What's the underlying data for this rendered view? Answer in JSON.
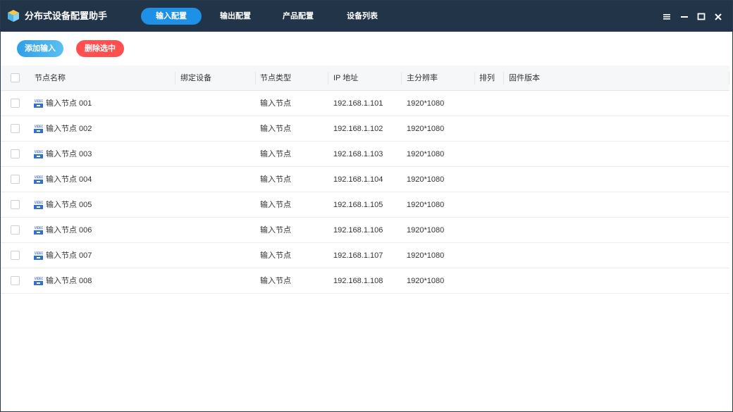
{
  "app": {
    "title": "分布式设备配置助手"
  },
  "tabs": [
    {
      "label": "输入配置",
      "active": true
    },
    {
      "label": "输出配置",
      "active": false
    },
    {
      "label": "产品配置",
      "active": false
    },
    {
      "label": "设备列表",
      "active": false
    }
  ],
  "window_controls": [
    "menu-icon",
    "minimize-icon",
    "maximize-icon",
    "close-icon"
  ],
  "toolbar": {
    "add_label": "添加输入",
    "delete_label": "删除选中"
  },
  "colors": {
    "titlebar": "#223447",
    "accent": "#1e90e6",
    "danger": "#ff4f4f"
  },
  "table": {
    "headers": {
      "name": "节点名称",
      "bind": "绑定设备",
      "type": "节点类型",
      "ip": "IP 地址",
      "resolution": "主分辨率",
      "order": "排列",
      "firmware": "固件版本"
    },
    "rows": [
      {
        "name": "输入节点 001",
        "bind": "",
        "type": "输入节点",
        "ip": "192.168.1.101",
        "resolution": "1920*1080",
        "order": "",
        "firmware": ""
      },
      {
        "name": "输入节点 002",
        "bind": "",
        "type": "输入节点",
        "ip": "192.168.1.102",
        "resolution": "1920*1080",
        "order": "",
        "firmware": ""
      },
      {
        "name": "输入节点 003",
        "bind": "",
        "type": "输入节点",
        "ip": "192.168.1.103",
        "resolution": "1920*1080",
        "order": "",
        "firmware": ""
      },
      {
        "name": "输入节点 004",
        "bind": "",
        "type": "输入节点",
        "ip": "192.168.1.104",
        "resolution": "1920*1080",
        "order": "",
        "firmware": ""
      },
      {
        "name": "输入节点 005",
        "bind": "",
        "type": "输入节点",
        "ip": "192.168.1.105",
        "resolution": "1920*1080",
        "order": "",
        "firmware": ""
      },
      {
        "name": "输入节点 006",
        "bind": "",
        "type": "输入节点",
        "ip": "192.168.1.106",
        "resolution": "1920*1080",
        "order": "",
        "firmware": ""
      },
      {
        "name": "输入节点 007",
        "bind": "",
        "type": "输入节点",
        "ip": "192.168.1.107",
        "resolution": "1920*1080",
        "order": "",
        "firmware": ""
      },
      {
        "name": "输入节点 008",
        "bind": "",
        "type": "输入节点",
        "ip": "192.168.1.108",
        "resolution": "1920*1080",
        "order": "",
        "firmware": ""
      }
    ]
  }
}
